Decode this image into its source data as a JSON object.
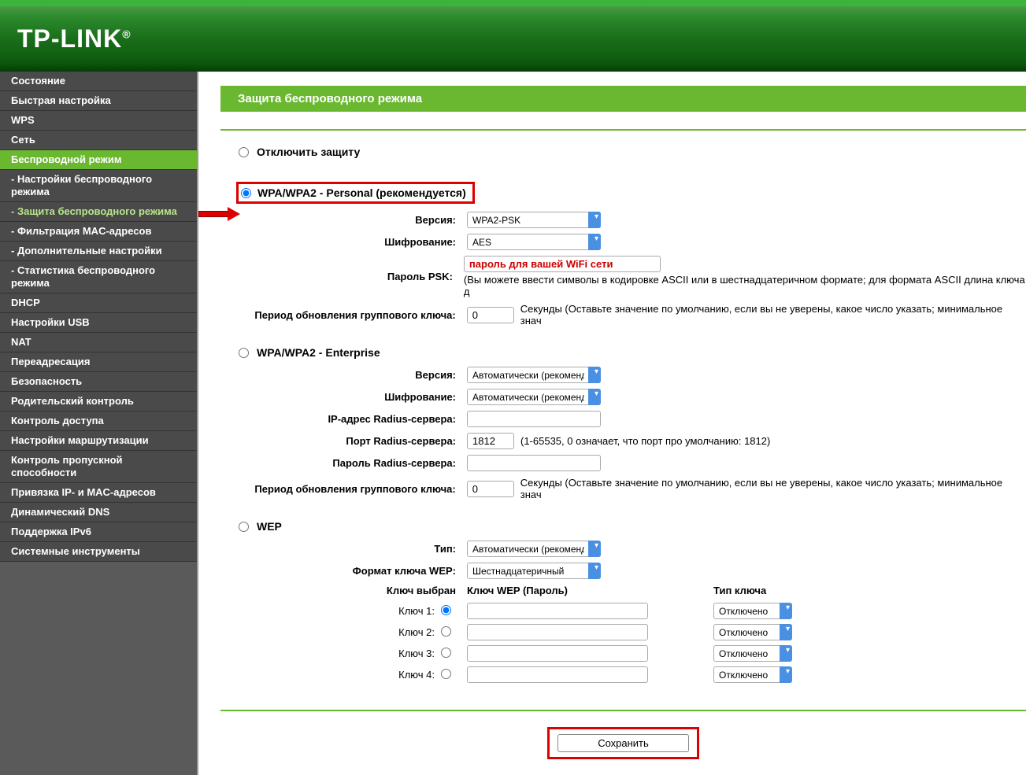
{
  "brand": "TP-LINK",
  "sidebar": {
    "items": [
      {
        "label": "Состояние",
        "type": "main"
      },
      {
        "label": "Быстрая настройка",
        "type": "main"
      },
      {
        "label": "WPS",
        "type": "main"
      },
      {
        "label": "Сеть",
        "type": "main"
      },
      {
        "label": "Беспроводной режим",
        "type": "main",
        "active": true
      },
      {
        "label": "- Настройки беспроводного режима",
        "type": "sub"
      },
      {
        "label": "- Защита беспроводного режима",
        "type": "sub",
        "activeSub": true
      },
      {
        "label": "- Фильтрация MAC-адресов",
        "type": "sub"
      },
      {
        "label": "- Дополнительные настройки",
        "type": "sub"
      },
      {
        "label": "- Статистика беспроводного режима",
        "type": "sub"
      },
      {
        "label": "DHCP",
        "type": "main"
      },
      {
        "label": "Настройки USB",
        "type": "main"
      },
      {
        "label": "NAT",
        "type": "main"
      },
      {
        "label": "Переадресация",
        "type": "main"
      },
      {
        "label": "Безопасность",
        "type": "main"
      },
      {
        "label": "Родительский контроль",
        "type": "main"
      },
      {
        "label": "Контроль доступа",
        "type": "main"
      },
      {
        "label": "Настройки маршрутизации",
        "type": "main"
      },
      {
        "label": "Контроль пропускной способности",
        "type": "main"
      },
      {
        "label": "Привязка IP- и MAC-адресов",
        "type": "main"
      },
      {
        "label": "Динамический DNS",
        "type": "main"
      },
      {
        "label": "Поддержка IPv6",
        "type": "main"
      },
      {
        "label": "Системные инструменты",
        "type": "main"
      }
    ]
  },
  "page": {
    "title": "Защита беспроводного режима",
    "disable_option": "Отключить защиту",
    "personal": {
      "title": "WPA/WPA2 - Personal (рекомендуется)",
      "version_label": "Версия:",
      "version_value": "WPA2-PSK",
      "encryption_label": "Шифрование:",
      "encryption_value": "AES",
      "psk_label": "Пароль PSK:",
      "psk_placeholder": "пароль для вашей WiFi сети",
      "psk_hint": "(Вы можете ввести символы в кодировке ASCII или в шестнадцатеричном формате; для формата ASCII длина ключа д",
      "group_key_label": "Период обновления группового ключа:",
      "group_key_value": "0",
      "group_key_hint": "Секунды (Оставьте значение по умолчанию, если вы не уверены, какое число указать; минимальное знач"
    },
    "enterprise": {
      "title": "WPA/WPA2 - Enterprise",
      "version_label": "Версия:",
      "version_value": "Автоматически (рекоменду",
      "encryption_label": "Шифрование:",
      "encryption_value": "Автоматически (рекоменду",
      "radius_ip_label": "IP-адрес Radius-сервера:",
      "radius_port_label": "Порт Radius-сервера:",
      "radius_port_value": "1812",
      "radius_port_hint": "(1-65535, 0 означает, что порт про умолчанию: 1812)",
      "radius_pass_label": "Пароль Radius-сервера:",
      "group_key_label": "Период обновления группового ключа:",
      "group_key_value": "0",
      "group_key_hint": "Секунды (Оставьте значение по умолчанию, если вы не уверены, какое число указать; минимальное знач"
    },
    "wep": {
      "title": "WEP",
      "type_label": "Тип:",
      "type_value": "Автоматически (рекоменду",
      "format_label": "Формат ключа WEP:",
      "format_value": "Шестнадцатеричный",
      "key_selected_header": "Ключ выбран",
      "key_password_header": "Ключ WEP (Пароль)",
      "key_type_header": "Тип ключа",
      "keys": [
        {
          "label": "Ключ 1:",
          "type": "Отключено"
        },
        {
          "label": "Ключ 2:",
          "type": "Отключено"
        },
        {
          "label": "Ключ 3:",
          "type": "Отключено"
        },
        {
          "label": "Ключ 4:",
          "type": "Отключено"
        }
      ]
    },
    "save_button": "Сохранить"
  }
}
